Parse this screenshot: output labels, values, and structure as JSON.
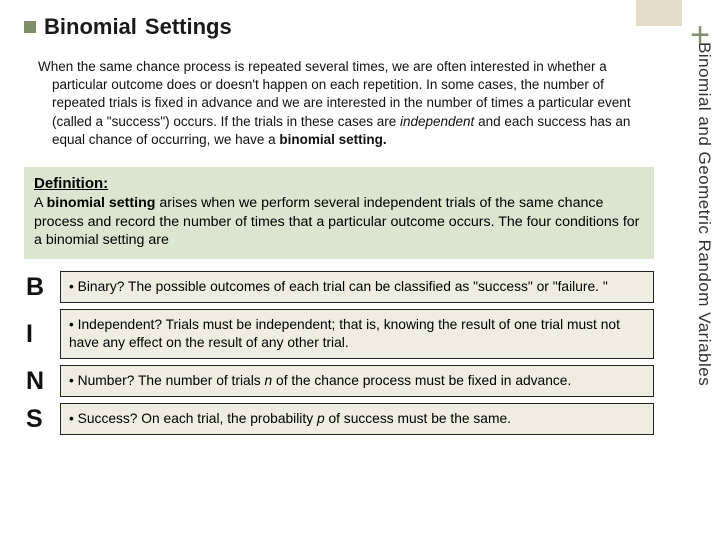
{
  "corner": {
    "plus": "+"
  },
  "side_label": "Binomial and Geometric Random Variables",
  "title": {
    "word1": "Binomial",
    "word2": "Settings"
  },
  "intro": {
    "p1": "When the same chance process is repeated several times, we are often interested in whether a particular outcome does or doesn't happen on each repetition. In some cases, the number of repeated trials is fixed in advance and we are interested in the number of times a particular event (called a \"success\") occurs. If the trials in these cases are ",
    "i1": "independent",
    "p2": " and each success has an equal chance of occurring, we have a ",
    "b1": "binomial setting.",
    "p3": ""
  },
  "definition": {
    "heading": "Definition:",
    "body_a": "A ",
    "body_b": "binomial setting",
    "body_c": " arises when we perform several independent trials of the same chance process and record the number of times that a particular outcome occurs. The four conditions for a binomial setting are"
  },
  "rows": [
    {
      "letter": "B",
      "text_a": "• Binary? The possible outcomes of each trial can be classified as \"success\" or \"failure. \"",
      "text_i": "",
      "text_b": ""
    },
    {
      "letter": "I",
      "text_a": "• Independent? Trials must be independent; that is, knowing the result of one trial must not have any effect on the result of any other trial.",
      "text_i": "",
      "text_b": ""
    },
    {
      "letter": "N",
      "text_a": "• Number? The number of trials ",
      "text_i": "n",
      "text_b": " of the chance process must be fixed in advance."
    },
    {
      "letter": "S",
      "text_a": "• Success? On each trial, the probability ",
      "text_i": "p",
      "text_b": " of success must be the same."
    }
  ]
}
